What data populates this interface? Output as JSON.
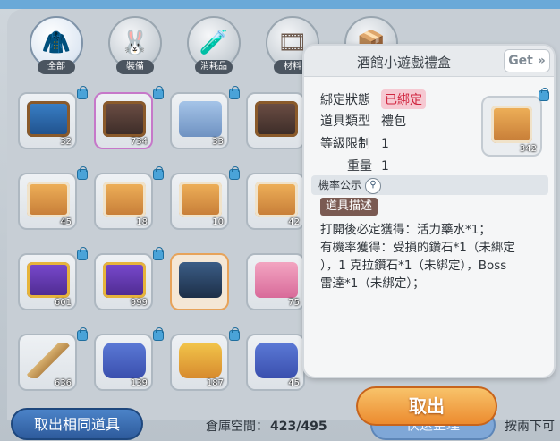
{
  "categories": [
    {
      "label": "全部",
      "icon": "🧥"
    },
    {
      "label": "裝備",
      "icon": "🐰"
    },
    {
      "label": "消耗品",
      "icon": "🧪"
    },
    {
      "label": "材料",
      "icon": "🎞"
    },
    {
      "label": "",
      "icon": "📦"
    }
  ],
  "grid": {
    "counts": [
      "32",
      "734",
      "33",
      "",
      "45",
      "18",
      "10",
      "42",
      "601",
      "999",
      "",
      "75",
      "636",
      "139",
      "187",
      "45"
    ]
  },
  "popup": {
    "title": "酒館小遊戲禮盒",
    "get_label": "Get »",
    "binding_key": "綁定狀態",
    "binding_val": "已綁定",
    "type_key": "道具類型",
    "type_val": "禮包",
    "level_key": "等級限制",
    "level_val": "1",
    "weight_key": "重量",
    "weight_val": "1",
    "item_count": "342",
    "probability_label": "機率公示",
    "desc_label": "道具描述",
    "description": "打開後必定獲得：活力藥水*1；\n有機率獲得：受損的鑽石*1（未綁定\n），1 克拉鑽石*1（未綁定），Boss\n雷達*1（未綁定）；"
  },
  "bottom": {
    "same_button": "取出相同道具",
    "storage_label": "倉庫空間：",
    "storage_value": "423/495",
    "quick_button": "快速整理",
    "take_button": "取出",
    "hint": "按兩下可"
  }
}
